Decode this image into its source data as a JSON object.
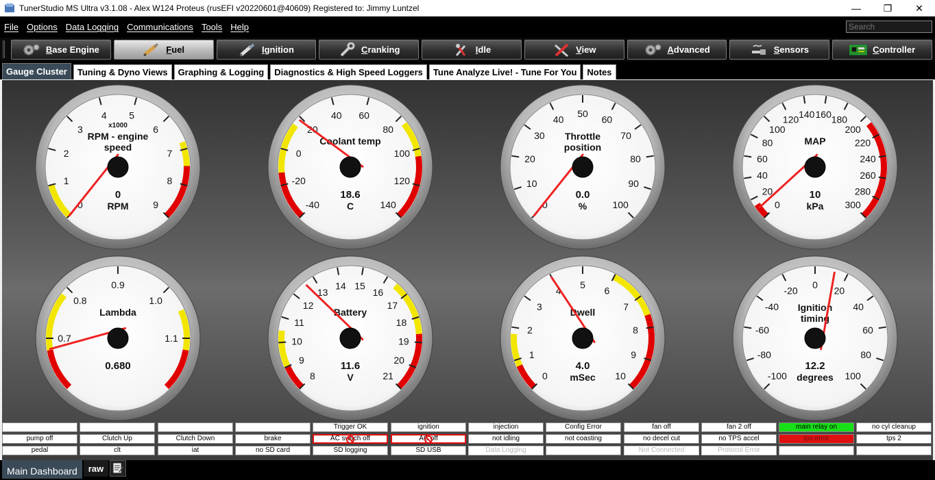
{
  "window": {
    "title": "TunerStudio MS Ultra v3.1.08 - Alex W124 Proteus (rusEFI v20220601@40609) Registered to: Jimmy Luntzel",
    "minimize": "—",
    "maximize": "❐",
    "close": "✕"
  },
  "menu": [
    "File",
    "Options",
    "Data Logging",
    "Communications",
    "Tools",
    "Help"
  ],
  "search": {
    "placeholder": "Search"
  },
  "toolbar": [
    {
      "label": "Base Engine",
      "icon": "gears-icon",
      "active": false
    },
    {
      "label": "Fuel",
      "icon": "injector-icon",
      "active": true
    },
    {
      "label": "Ignition",
      "icon": "spark-plug-icon",
      "active": false
    },
    {
      "label": "Cranking",
      "icon": "wrench-icon",
      "active": false
    },
    {
      "label": "Idle",
      "icon": "tools-icon",
      "active": false
    },
    {
      "label": "View",
      "icon": "crossed-tools-icon",
      "active": false
    },
    {
      "label": "Advanced",
      "icon": "gears-icon",
      "active": false
    },
    {
      "label": "Sensors",
      "icon": "sensor-icon",
      "active": false
    },
    {
      "label": "Controller",
      "icon": "circuit-board-icon",
      "active": false
    }
  ],
  "tabs": [
    "Gauge Cluster",
    "Tuning & Dyno Views",
    "Graphing & Logging",
    "Diagnostics & High Speed Loggers",
    "Tune Analyze Live! - Tune For You",
    "Notes"
  ],
  "gauges": [
    {
      "title": [
        "RPM - engine",
        "speed"
      ],
      "subtitle": "x1000",
      "value": "0",
      "units": "RPM",
      "min": 0,
      "max": 9,
      "ticks": [
        "0",
        "1",
        "2",
        "3",
        "4",
        "5",
        "6",
        "7",
        "8",
        "9"
      ],
      "needle": 0.0,
      "bands": [
        {
          "from": 0.0,
          "to": 0.11,
          "color": "#f2e600"
        },
        {
          "from": 0.755,
          "to": 0.83,
          "color": "#f2e600"
        },
        {
          "from": 0.83,
          "to": 1.0,
          "color": "#e00000"
        }
      ],
      "redInner": [
        0.0,
        0.028
      ]
    },
    {
      "title": [
        "Coolant temp"
      ],
      "value": "18.6",
      "units": "C",
      "min": -40,
      "max": 140,
      "ticks": [
        "-40",
        "-20",
        "0",
        "20",
        "40",
        "60",
        "80",
        "100",
        "120",
        "140"
      ],
      "needle": 0.3256,
      "bands": [
        {
          "from": 0.0,
          "to": 0.15,
          "color": "#e00000"
        },
        {
          "from": 0.15,
          "to": 0.305,
          "color": "#f2e600"
        },
        {
          "from": 0.69,
          "to": 0.8,
          "color": "#f2e600"
        },
        {
          "from": 0.8,
          "to": 1.0,
          "color": "#e00000"
        }
      ]
    },
    {
      "title": [
        "Throttle",
        "position"
      ],
      "value": "0.0",
      "units": "%",
      "min": 0,
      "max": 100,
      "ticks": [
        "0",
        "10",
        "20",
        "30",
        "40",
        "50",
        "60",
        "70",
        "80",
        "90",
        "100"
      ],
      "needle": 0.0,
      "bands": []
    },
    {
      "title": [
        "MAP"
      ],
      "value": "10",
      "units": "kPa",
      "min": 0,
      "max": 300,
      "ticks": [
        "0",
        "20",
        "40",
        "60",
        "80",
        "100",
        "120",
        "140",
        "160",
        "180",
        "200",
        "220",
        "240",
        "260",
        "280",
        "300"
      ],
      "needle": 0.0333,
      "bands": [
        {
          "from": 0.0,
          "to": 0.045,
          "color": "#e00000"
        },
        {
          "from": 0.69,
          "to": 1.0,
          "color": "#e00000"
        }
      ]
    },
    {
      "title": [
        "Lambda"
      ],
      "value": "0.680",
      "units": "",
      "min": 0.6,
      "max": 1.2,
      "ticks": [
        "0.7",
        "0.8",
        "0.9",
        "1.0",
        "1.1"
      ],
      "tickFrac": [
        0.1667,
        0.3333,
        0.5,
        0.6667,
        0.8333
      ],
      "needle": 0.1333,
      "bands": [
        {
          "from": 0.0,
          "to": 0.13,
          "color": "#e00000"
        },
        {
          "from": 0.13,
          "to": 0.31,
          "color": "#f2e600"
        },
        {
          "from": 0.745,
          "to": 0.87,
          "color": "#f2e600"
        },
        {
          "from": 0.87,
          "to": 1.0,
          "color": "#e00000"
        }
      ]
    },
    {
      "title": [
        "Battery"
      ],
      "value": "11.6",
      "units": "V",
      "min": 8,
      "max": 21,
      "ticks": [
        "8",
        "9",
        "10",
        "11",
        "12",
        "13",
        "14",
        "15",
        "16",
        "17",
        "18",
        "19",
        "20",
        "21"
      ],
      "needle": 0.3538,
      "bands": [
        {
          "from": 0.0,
          "to": 0.075,
          "color": "#e00000"
        },
        {
          "from": 0.075,
          "to": 0.19,
          "color": "#f2e600"
        },
        {
          "from": 0.65,
          "to": 0.82,
          "color": "#f2e600"
        },
        {
          "from": 0.82,
          "to": 1.0,
          "color": "#e00000"
        }
      ]
    },
    {
      "title": [
        "Dwell"
      ],
      "value": "4.0",
      "units": "mSec",
      "min": 0,
      "max": 10,
      "ticks": [
        "0",
        "1",
        "2",
        "3",
        "4",
        "5",
        "6",
        "7",
        "8",
        "9",
        "10"
      ],
      "needle": 0.4,
      "bands": [
        {
          "from": 0.0,
          "to": 0.08,
          "color": "#e00000"
        },
        {
          "from": 0.08,
          "to": 0.18,
          "color": "#f2e600"
        },
        {
          "from": 0.6,
          "to": 0.76,
          "color": "#f2e600"
        },
        {
          "from": 0.76,
          "to": 1.0,
          "color": "#e00000"
        }
      ]
    },
    {
      "title": [
        "Ignition",
        "timing"
      ],
      "value": "12.2",
      "units": "degrees",
      "min": -100,
      "max": 100,
      "ticks": [
        "-100",
        "-80",
        "-60",
        "-40",
        "-20",
        "0",
        "20",
        "40",
        "60",
        "80",
        "100"
      ],
      "needle": 0.561,
      "bands": []
    }
  ],
  "indicators": [
    [
      "",
      "",
      "",
      "",
      "Trigger OK",
      "ignition",
      "injection",
      "Config Error",
      "fan off",
      "fan 2 off",
      "main relay on",
      "no cyl cleanup"
    ],
    [
      "pump off",
      "Clutch Up",
      "Clutch Down",
      "brake",
      "AC switch off",
      "AC off",
      "not idling",
      "not coasting",
      "no decel cut",
      "no TPS accel",
      "tps error",
      "tps 2"
    ],
    [
      "pedal",
      "clt",
      "iat",
      "no SD card",
      "SD logging",
      "SD USB",
      "Data Logging",
      "",
      "Not Connected",
      "Protocol Error",
      "",
      ""
    ]
  ],
  "indicatorStyles": {
    "0.10": "green",
    "1.10": "red",
    "1.4": "alert",
    "1.5": "alert",
    "2.6": "dim",
    "2.8": "dim",
    "2.9": "dim"
  },
  "bottomTabs": [
    "Main Dashboard",
    "raw"
  ],
  "colors": {
    "red": "#e00000",
    "yellow": "#f2e600",
    "green": "#17e017",
    "tabActive": "#3a4a58"
  }
}
